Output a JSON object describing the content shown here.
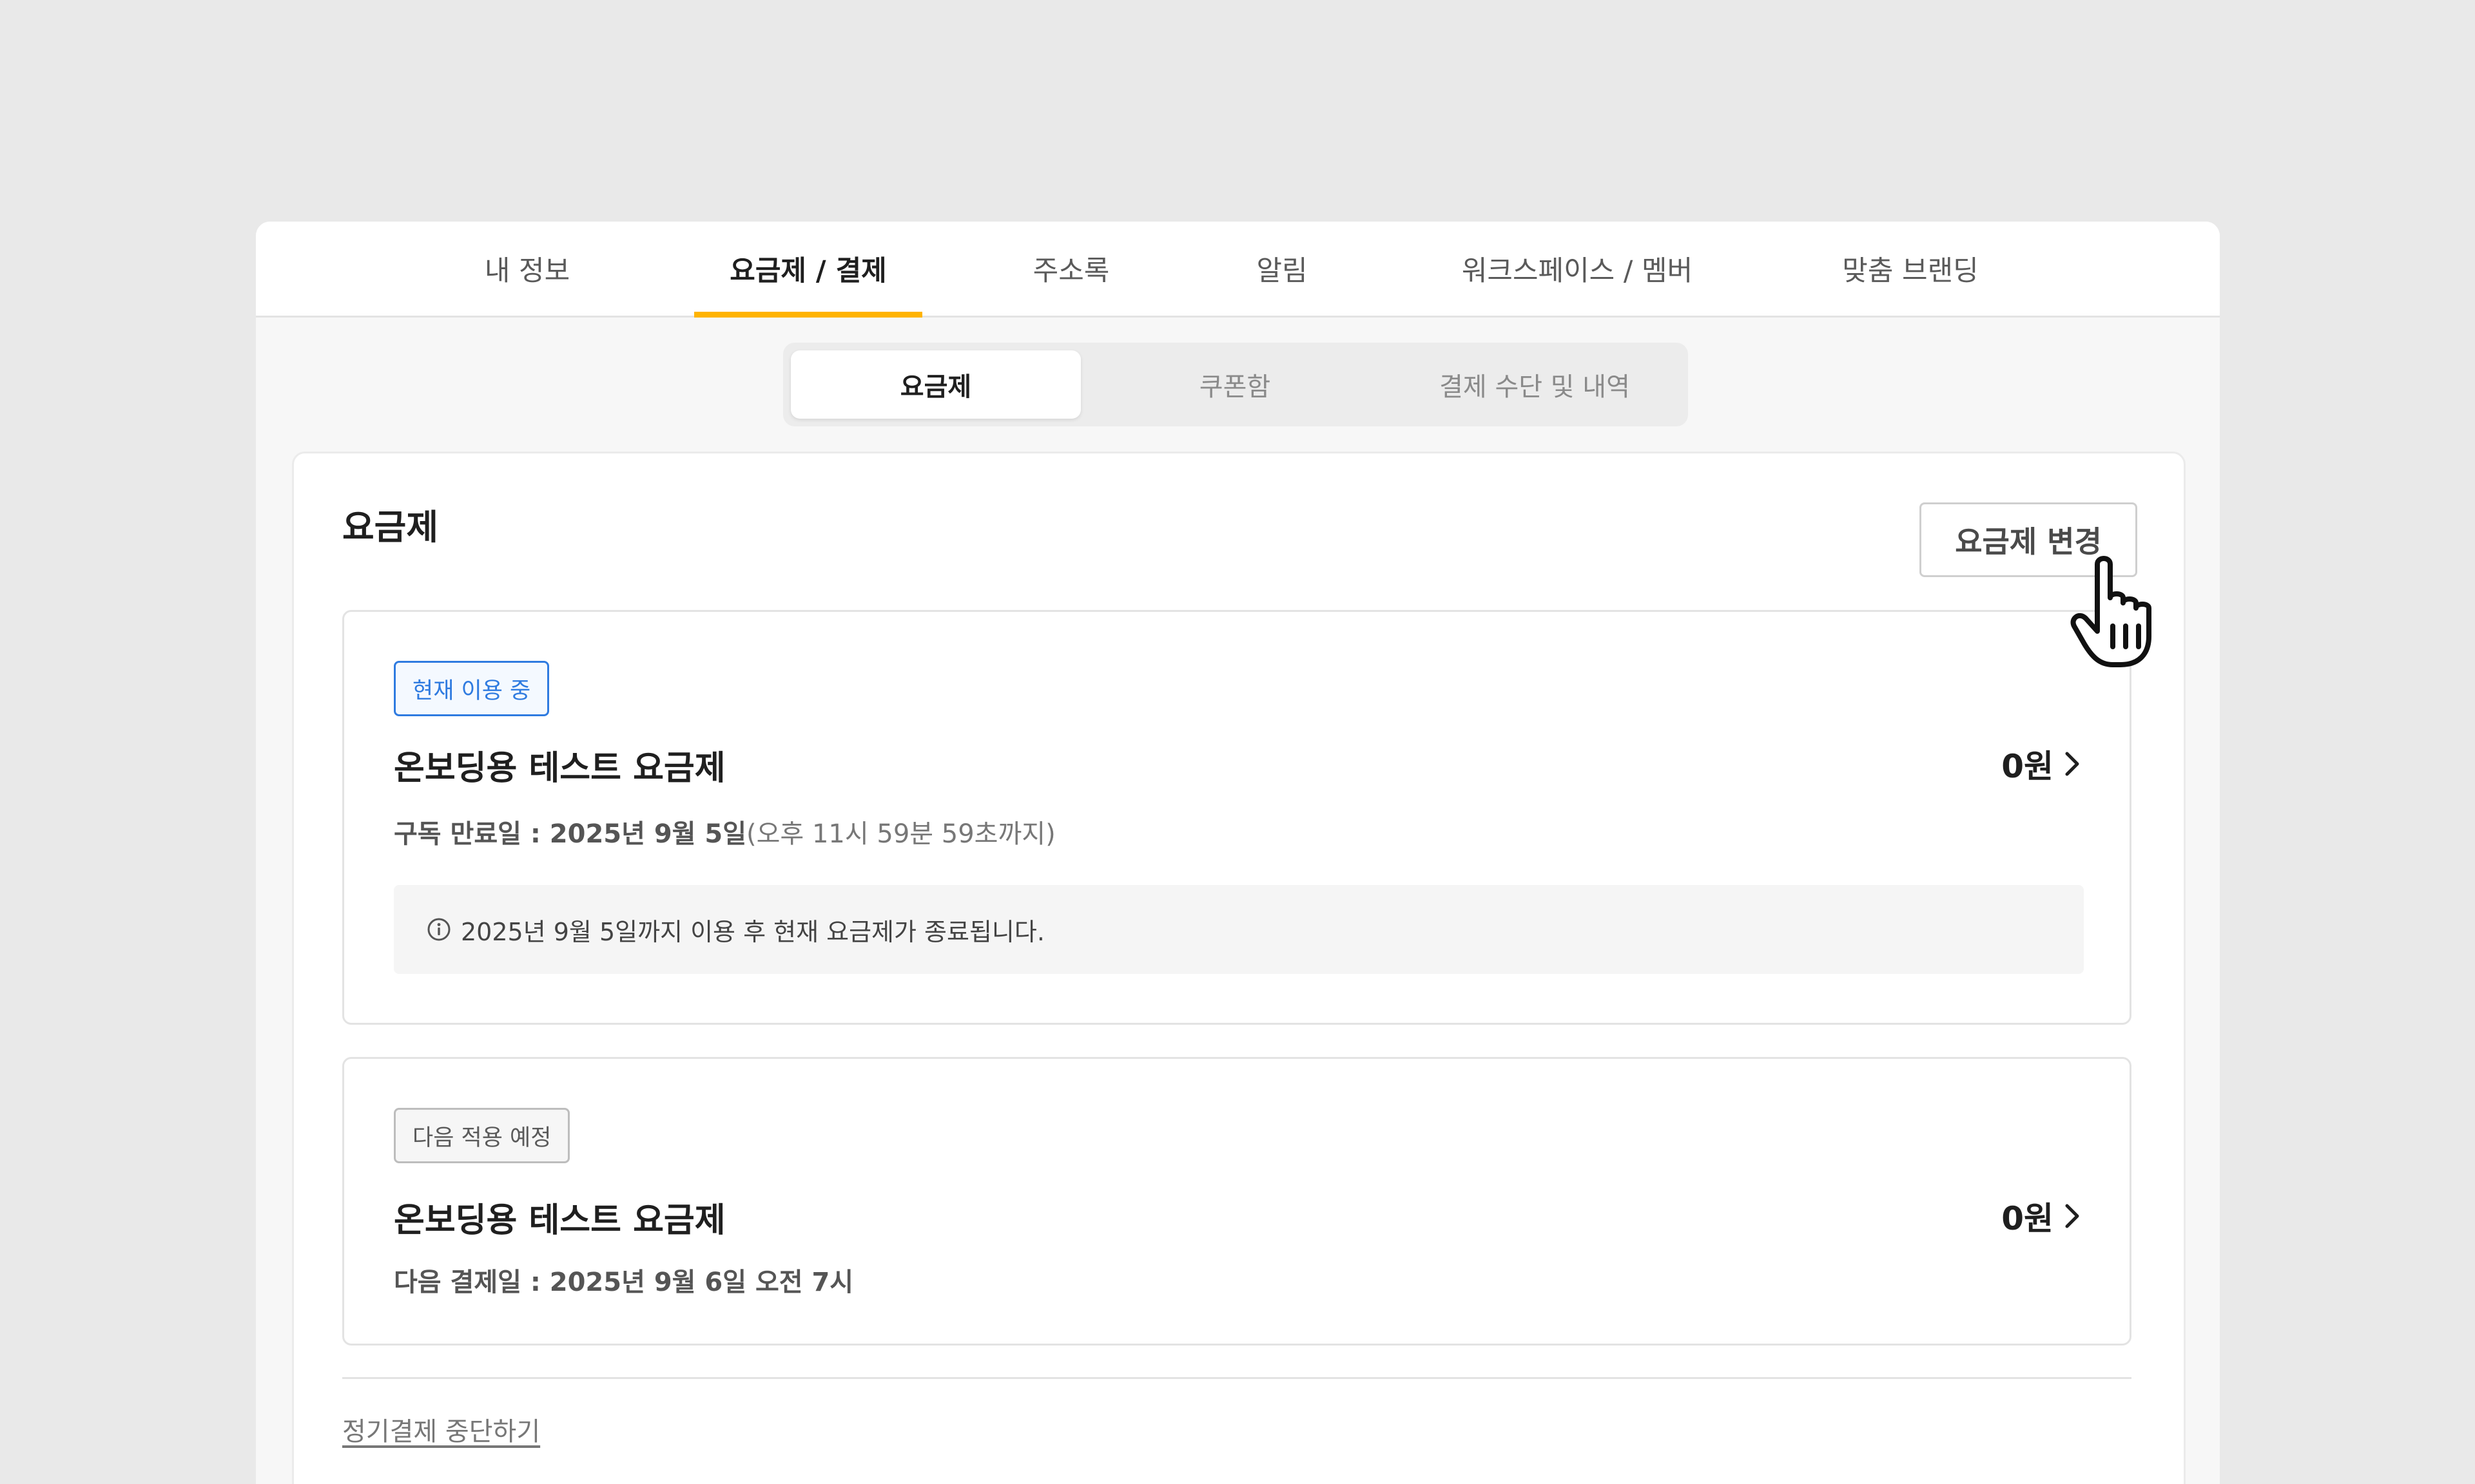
{
  "top_nav": {
    "tabs": [
      {
        "label": "내 정보",
        "active": false
      },
      {
        "label": "요금제 / 결제",
        "active": true
      },
      {
        "label": "주소록",
        "active": false
      },
      {
        "label": "알림",
        "active": false
      },
      {
        "label": "워크스페이스 / 멤버",
        "active": false
      },
      {
        "label": "맞춤 브랜딩",
        "active": false
      }
    ],
    "accent_color": "#ffb400"
  },
  "sub_tabs": [
    {
      "label": "요금제",
      "active": true
    },
    {
      "label": "쿠폰함",
      "active": false
    },
    {
      "label": "결제 수단 및 내역",
      "active": false
    }
  ],
  "section": {
    "title": "요금제",
    "change_button": "요금제 변경"
  },
  "current_plan": {
    "badge": "현재 이용 중",
    "name": "온보딩용 테스트 요금제",
    "price": "0원",
    "expiry_label": "구독 만료일 : ",
    "expiry_date": "2025년 9월 5일",
    "expiry_time": "(오후 11시 59분 59초까지)",
    "notice": "2025년 9월 5일까지 이용 후 현재 요금제가 종료됩니다.",
    "badge_color": "#2f7be0"
  },
  "next_plan": {
    "badge": "다음 적용 예정",
    "name": "온보딩용 테스트 요금제",
    "price": "0원",
    "billing_line": "다음 결제일 : 2025년 9월 6일 오전 7시"
  },
  "stop_link": "정기결제 중단하기"
}
